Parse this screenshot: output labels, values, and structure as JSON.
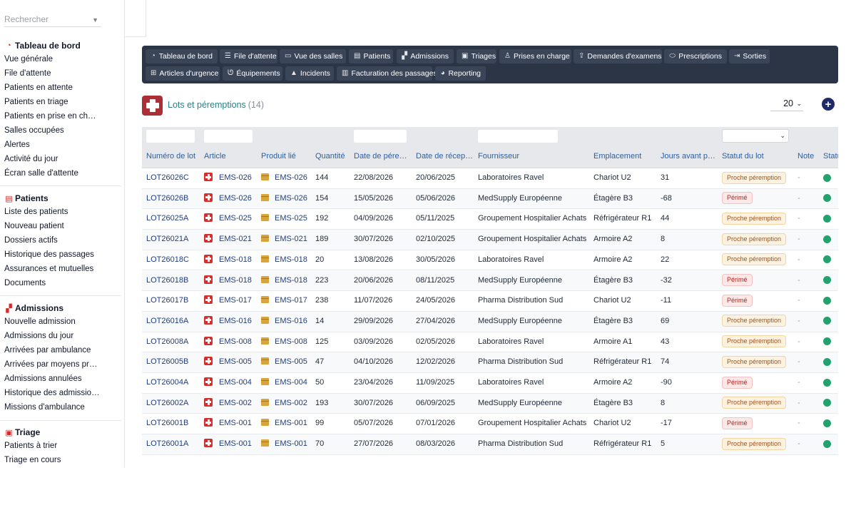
{
  "search": {
    "placeholder": "Rechercher"
  },
  "sidebar": {
    "groups": [
      {
        "title": "Tableau de bord",
        "icon": "gauge-icon",
        "items": [
          "Vue générale",
          "File d'attente",
          "Patients en attente",
          "Patients en triage",
          "Patients en prise en charge",
          "Salles occupées",
          "Alertes",
          "Activité du jour",
          "Écran salle d'attente"
        ]
      },
      {
        "title": "Patients",
        "icon": "id-card-icon",
        "items": [
          "Liste des patients",
          "Nouveau patient",
          "Dossiers actifs",
          "Historique des passages",
          "Assurances et mutuelles",
          "Documents"
        ]
      },
      {
        "title": "Admissions",
        "icon": "person-bed-icon",
        "items": [
          "Nouvelle admission",
          "Admissions du jour",
          "Arrivées par ambulance",
          "Arrivées par moyens propres",
          "Admissions annulées",
          "Historique des admissions",
          "Missions d'ambulance"
        ]
      },
      {
        "title": "Triage",
        "icon": "clipboard-icon",
        "items": [
          "Patients à trier",
          "Triage en cours"
        ]
      }
    ]
  },
  "modules": [
    {
      "label": "Tableau de bord",
      "icon": "gauge-icon"
    },
    {
      "label": "File d'attente",
      "icon": "list-icon"
    },
    {
      "label": "Vue des salles",
      "icon": "bed-icon"
    },
    {
      "label": "Patients",
      "icon": "id-card-icon"
    },
    {
      "label": "Admissions",
      "icon": "person-bed-icon"
    },
    {
      "label": "Triages",
      "icon": "clipboard-icon"
    },
    {
      "label": "Prises en charge",
      "icon": "user-doctor-icon"
    },
    {
      "label": "Demandes d'examens",
      "icon": "upload-icon"
    },
    {
      "label": "Prescriptions",
      "icon": "pills-icon"
    },
    {
      "label": "Sorties",
      "icon": "exit-icon"
    },
    {
      "label": "Articles d'urgence",
      "icon": "sitemap-icon"
    },
    {
      "label": "Équipements",
      "icon": "stethoscope-icon"
    },
    {
      "label": "Incidents",
      "icon": "warning-icon"
    },
    {
      "label": "Facturation des passages",
      "icon": "invoice-icon"
    },
    {
      "label": "Reporting",
      "icon": "pie-chart-icon"
    }
  ],
  "header": {
    "title": "Lots et péremptions",
    "count": "(14)",
    "per_page": "20"
  },
  "table": {
    "columns": [
      "Numéro de lot",
      "Article",
      "Produit lié",
      "Quantité",
      "Date de péremption",
      "Date de réception",
      "Fournisseur",
      "Emplacement",
      "Jours avant péremption",
      "Statut du lot",
      "Note",
      "Statut"
    ],
    "rows": [
      {
        "lot": "LOT26026C",
        "article": "EMS-026",
        "produit": "EMS-026",
        "qty": "144",
        "peremption": "22/08/2026",
        "reception": "20/06/2025",
        "fournisseur": "Laboratoires Ravel",
        "emplacement": "Chariot U2",
        "jours": "31",
        "statut": "Proche péremption",
        "statut_kind": "warn",
        "note": "-"
      },
      {
        "lot": "LOT26026B",
        "article": "EMS-026",
        "produit": "EMS-026",
        "qty": "154",
        "peremption": "15/05/2026",
        "reception": "05/06/2026",
        "fournisseur": "MedSupply Européenne",
        "emplacement": "Étagère B3",
        "jours": "-68",
        "statut": "Périmé",
        "statut_kind": "danger",
        "note": "-"
      },
      {
        "lot": "LOT26025A",
        "article": "EMS-025",
        "produit": "EMS-025",
        "qty": "192",
        "peremption": "04/09/2026",
        "reception": "05/11/2025",
        "fournisseur": "Groupement Hospitalier Achats",
        "emplacement": "Réfrigérateur R1",
        "jours": "44",
        "statut": "Proche péremption",
        "statut_kind": "warn",
        "note": "-"
      },
      {
        "lot": "LOT26021A",
        "article": "EMS-021",
        "produit": "EMS-021",
        "qty": "189",
        "peremption": "30/07/2026",
        "reception": "02/10/2025",
        "fournisseur": "Groupement Hospitalier Achats",
        "emplacement": "Armoire A2",
        "jours": "8",
        "statut": "Proche péremption",
        "statut_kind": "warn",
        "note": "-"
      },
      {
        "lot": "LOT26018C",
        "article": "EMS-018",
        "produit": "EMS-018",
        "qty": "20",
        "peremption": "13/08/2026",
        "reception": "30/05/2026",
        "fournisseur": "Laboratoires Ravel",
        "emplacement": "Armoire A2",
        "jours": "22",
        "statut": "Proche péremption",
        "statut_kind": "warn",
        "note": "-"
      },
      {
        "lot": "LOT26018B",
        "article": "EMS-018",
        "produit": "EMS-018",
        "qty": "223",
        "peremption": "20/06/2026",
        "reception": "08/11/2025",
        "fournisseur": "MedSupply Européenne",
        "emplacement": "Étagère B3",
        "jours": "-32",
        "statut": "Périmé",
        "statut_kind": "danger",
        "note": "-"
      },
      {
        "lot": "LOT26017B",
        "article": "EMS-017",
        "produit": "EMS-017",
        "qty": "238",
        "peremption": "11/07/2026",
        "reception": "24/05/2026",
        "fournisseur": "Pharma Distribution Sud",
        "emplacement": "Chariot U2",
        "jours": "-11",
        "statut": "Périmé",
        "statut_kind": "danger",
        "note": "-"
      },
      {
        "lot": "LOT26016A",
        "article": "EMS-016",
        "produit": "EMS-016",
        "qty": "14",
        "peremption": "29/09/2026",
        "reception": "27/04/2026",
        "fournisseur": "MedSupply Européenne",
        "emplacement": "Étagère B3",
        "jours": "69",
        "statut": "Proche péremption",
        "statut_kind": "warn",
        "note": "-"
      },
      {
        "lot": "LOT26008A",
        "article": "EMS-008",
        "produit": "EMS-008",
        "qty": "125",
        "peremption": "03/09/2026",
        "reception": "02/05/2026",
        "fournisseur": "Laboratoires Ravel",
        "emplacement": "Armoire A1",
        "jours": "43",
        "statut": "Proche péremption",
        "statut_kind": "warn",
        "note": "-"
      },
      {
        "lot": "LOT26005B",
        "article": "EMS-005",
        "produit": "EMS-005",
        "qty": "47",
        "peremption": "04/10/2026",
        "reception": "12/02/2026",
        "fournisseur": "Pharma Distribution Sud",
        "emplacement": "Réfrigérateur R1",
        "jours": "74",
        "statut": "Proche péremption",
        "statut_kind": "warn",
        "note": "-"
      },
      {
        "lot": "LOT26004A",
        "article": "EMS-004",
        "produit": "EMS-004",
        "qty": "50",
        "peremption": "23/04/2026",
        "reception": "11/09/2025",
        "fournisseur": "Laboratoires Ravel",
        "emplacement": "Armoire A2",
        "jours": "-90",
        "statut": "Périmé",
        "statut_kind": "danger",
        "note": "-"
      },
      {
        "lot": "LOT26002A",
        "article": "EMS-002",
        "produit": "EMS-002",
        "qty": "193",
        "peremption": "30/07/2026",
        "reception": "06/09/2025",
        "fournisseur": "MedSupply Européenne",
        "emplacement": "Étagère B3",
        "jours": "8",
        "statut": "Proche péremption",
        "statut_kind": "warn",
        "note": "-"
      },
      {
        "lot": "LOT26001B",
        "article": "EMS-001",
        "produit": "EMS-001",
        "qty": "99",
        "peremption": "05/07/2026",
        "reception": "07/01/2026",
        "fournisseur": "Groupement Hospitalier Achats",
        "emplacement": "Chariot U2",
        "jours": "-17",
        "statut": "Périmé",
        "statut_kind": "danger",
        "note": "-"
      },
      {
        "lot": "LOT26001A",
        "article": "EMS-001",
        "produit": "EMS-001",
        "qty": "70",
        "peremption": "27/07/2026",
        "reception": "08/03/2026",
        "fournisseur": "Pharma Distribution Sud",
        "emplacement": "Réfrigérateur R1",
        "jours": "5",
        "statut": "Proche péremption",
        "statut_kind": "warn",
        "note": "-"
      }
    ]
  },
  "colors": {
    "nav_bg": "#2b3546",
    "accent": "#2b7f85",
    "link": "#1f3d80",
    "status_ok": "#23a26d",
    "danger": "#b42323"
  }
}
